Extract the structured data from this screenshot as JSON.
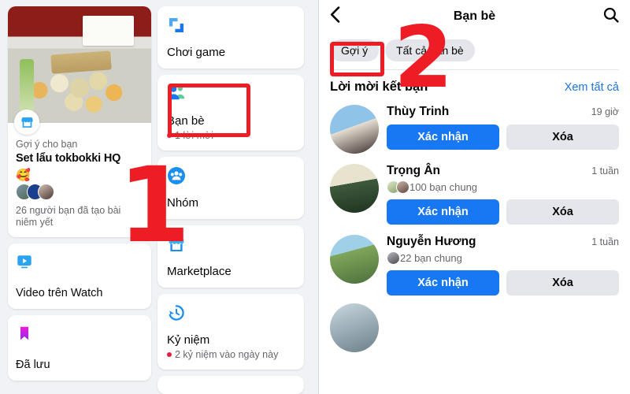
{
  "left_panel": {
    "suggestion_card": {
      "badge_icon": "marketplace-store-icon",
      "subtitle": "Gợi ý cho bạn",
      "title": "Set lẩu tokbokki HQ",
      "emoji": "🥰",
      "meta": "26 người bạn đã tạo bài niêm yết"
    },
    "left_column_items": [
      {
        "icon": "watch-video-icon",
        "label": "Video trên Watch"
      },
      {
        "icon": "bookmark-saved-icon",
        "label": "Đã lưu"
      }
    ],
    "right_column_items": [
      {
        "icon": "gaming-controller-icon",
        "label": "Chơi game",
        "sub": "",
        "highlighted": false
      },
      {
        "icon": "friends-people-icon",
        "label": "Bạn bè",
        "sub": "1 lời mời",
        "highlighted": true
      },
      {
        "icon": "groups-icon",
        "label": "Nhóm",
        "sub": "",
        "highlighted": false
      },
      {
        "icon": "marketplace-store-icon",
        "label": "Marketplace",
        "sub": "",
        "highlighted": false
      },
      {
        "icon": "memories-clock-icon",
        "label": "Kỷ niệm",
        "sub": "2 kỷ niệm vào ngày này",
        "highlighted": false
      }
    ]
  },
  "right_panel": {
    "header": {
      "back_icon": "back-chevron-icon",
      "title": "Bạn bè",
      "search_icon": "search-icon"
    },
    "tabs": [
      {
        "label": "Gợi ý",
        "selected": true
      },
      {
        "label": "Tất cả bạn bè",
        "selected": false
      }
    ],
    "section": {
      "title": "Lời mời kết bạn",
      "see_all": "Xem tất cả"
    },
    "requests": [
      {
        "name": "Thùy Trinh",
        "time": "19 giờ",
        "mutual": "",
        "confirm_label": "Xác nhận",
        "delete_label": "Xóa"
      },
      {
        "name": "Trọng Ân",
        "time": "1 tuần",
        "mutual": "100 bạn chung",
        "confirm_label": "Xác nhận",
        "delete_label": "Xóa"
      },
      {
        "name": "Nguyễn Hương",
        "time": "1 tuần",
        "mutual": "22 bạn chung",
        "confirm_label": "Xác nhận",
        "delete_label": "Xóa"
      }
    ]
  },
  "annotations": [
    {
      "number": "1",
      "target": "ban-be-menu-card"
    },
    {
      "number": "2",
      "target": "goi-y-tab"
    }
  ],
  "colors": {
    "facebook_blue": "#1877f2",
    "link_blue": "#1b74e4",
    "annotation_red": "#ee1c25",
    "badge_red": "#e41e3f",
    "page_bg": "#f0f2f5",
    "secondary_btn": "#e4e6eb"
  }
}
